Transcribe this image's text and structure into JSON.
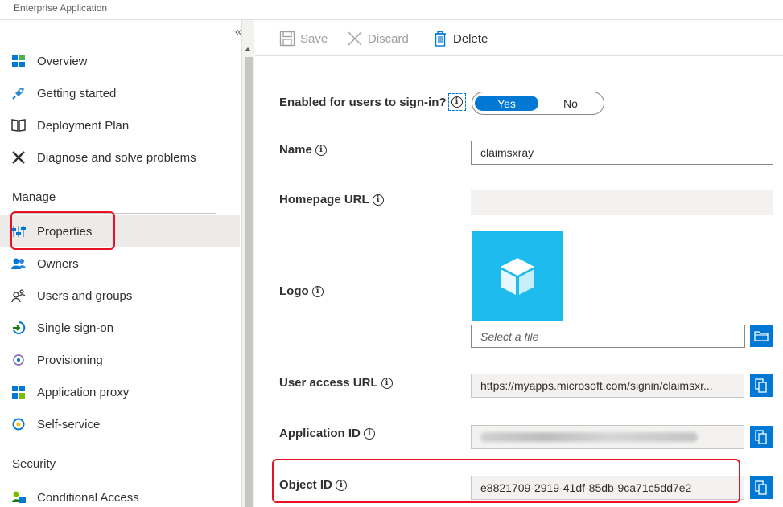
{
  "header": {
    "subtitle": "Enterprise Application"
  },
  "sidebar": {
    "collapse_glyph": "«",
    "items": [
      {
        "label": "Overview",
        "icon": "overview-grid-icon"
      },
      {
        "label": "Getting started",
        "icon": "rocket-icon"
      },
      {
        "label": "Deployment Plan",
        "icon": "book-icon"
      },
      {
        "label": "Diagnose and solve problems",
        "icon": "tools-icon"
      }
    ],
    "manage_header": "Manage",
    "manage_items": [
      {
        "label": "Properties",
        "icon": "properties-sliders-icon",
        "selected": true
      },
      {
        "label": "Owners",
        "icon": "owners-icon"
      },
      {
        "label": "Users and groups",
        "icon": "users-groups-icon"
      },
      {
        "label": "Single sign-on",
        "icon": "sso-icon"
      },
      {
        "label": "Provisioning",
        "icon": "provisioning-icon"
      },
      {
        "label": "Application proxy",
        "icon": "app-proxy-icon"
      },
      {
        "label": "Self-service",
        "icon": "self-service-icon"
      }
    ],
    "security_header": "Security",
    "security_items": [
      {
        "label": "Conditional Access",
        "icon": "conditional-access-icon"
      }
    ]
  },
  "toolbar": {
    "save": "Save",
    "discard": "Discard",
    "delete": "Delete"
  },
  "form": {
    "enabled_label": "Enabled for users to sign-in?",
    "toggle_yes": "Yes",
    "toggle_no": "No",
    "name_label": "Name",
    "name_value": "claimsxray",
    "homepage_label": "Homepage URL",
    "homepage_value": "",
    "logo_label": "Logo",
    "logo_placeholder": "Select a file",
    "user_access_label": "User access URL",
    "user_access_value": "https://myapps.microsoft.com/signin/claimsxr...",
    "app_id_label": "Application ID",
    "object_id_label": "Object ID",
    "object_id_value": "e8821709-2919-41df-85db-9ca71c5dd7e2"
  },
  "colors": {
    "accent": "#0078d4",
    "highlight": "#e81123",
    "logo_bg": "#1ebbee"
  }
}
